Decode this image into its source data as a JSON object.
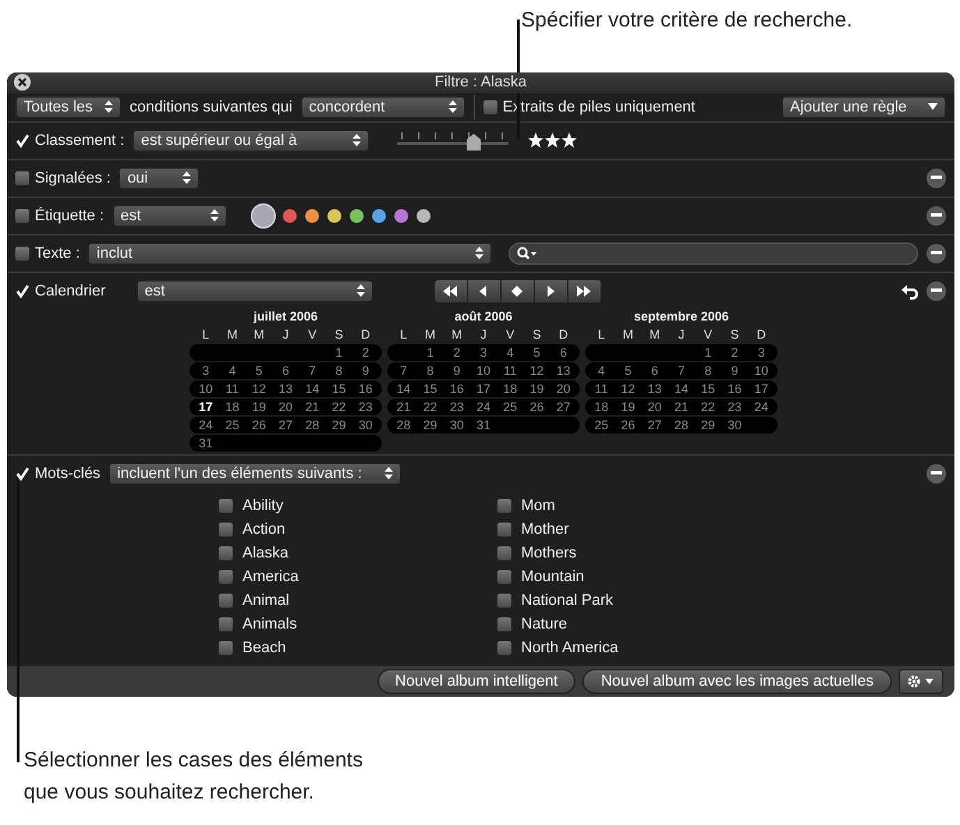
{
  "callouts": [
    {
      "text": "Spécifier votre critère de recherche."
    },
    {
      "text": "Sélectionner les cases des éléments que vous souhaitez rechercher."
    }
  ],
  "window": {
    "title": "Filtre : Alaska"
  },
  "toolbar": {
    "match_popup": "Toutes les",
    "text": "conditions suivantes qui",
    "mode_popup": "concordent",
    "stacks_checkbox": {
      "label": "Extraits de piles uniquement",
      "checked": false
    },
    "add_rule": "Ajouter une règle"
  },
  "rules": [
    {
      "kind": "rating",
      "label": "Classement :",
      "checked": true,
      "operator": "est supérieur ou égal à",
      "level": 0.68,
      "stars": 3
    },
    {
      "kind": "flag",
      "label": "Signalées :",
      "checked": false,
      "operator": "oui"
    },
    {
      "kind": "labels",
      "label": "Étiquette :",
      "checked": false,
      "operator": "est",
      "colors": [
        {
          "color": "#a8a8b4",
          "selected": true
        },
        {
          "color": "#e05858",
          "selected": false
        },
        {
          "color": "#e8924a",
          "selected": false
        },
        {
          "color": "#d8c658",
          "selected": false
        },
        {
          "color": "#78c060",
          "selected": false
        },
        {
          "color": "#58a4e4",
          "selected": false
        },
        {
          "color": "#b478d4",
          "selected": false
        },
        {
          "color": "#b8b8b8",
          "selected": false
        }
      ]
    },
    {
      "kind": "text",
      "label": "Texte :",
      "checked": false,
      "operator": "inclut"
    },
    {
      "kind": "calendar",
      "label": "Calendrier",
      "checked": true,
      "operator": "est",
      "months": [
        {
          "title": "juillet 2006",
          "weekdays": [
            "L",
            "M",
            "M",
            "J",
            "V",
            "S",
            "D"
          ],
          "weeks": [
            {
              "right_aligned": true,
              "days": [
                "1",
                "2"
              ]
            },
            {
              "days": [
                "3",
                "4",
                "5",
                "6",
                "7",
                "8",
                "9"
              ]
            },
            {
              "days": [
                "10",
                "11",
                "12",
                "13",
                "14",
                "15",
                "16"
              ]
            },
            {
              "days": [
                {
                  "day": "17",
                  "today": true
                },
                "18",
                "19",
                "20",
                "21",
                "22",
                "23"
              ]
            },
            {
              "days": [
                "24",
                "25",
                "26",
                "27",
                "28",
                "29",
                "30"
              ]
            },
            {
              "days": [
                "31"
              ]
            }
          ]
        },
        {
          "title": "août 2006",
          "weekdays": [
            "L",
            "M",
            "M",
            "J",
            "V",
            "S",
            "D"
          ],
          "weeks": [
            {
              "right_aligned": true,
              "days": [
                "1",
                "2",
                "3",
                "4",
                "5",
                "6"
              ]
            },
            {
              "days": [
                "7",
                "8",
                "9",
                "10",
                "11",
                "12",
                "13"
              ]
            },
            {
              "days": [
                "14",
                "15",
                "16",
                "17",
                "18",
                "19",
                "20"
              ]
            },
            {
              "days": [
                "21",
                "22",
                "23",
                "24",
                "25",
                "26",
                "27"
              ]
            },
            {
              "days": [
                "28",
                "29",
                "30",
                "31"
              ]
            }
          ]
        },
        {
          "title": "septembre 2006",
          "weekdays": [
            "L",
            "M",
            "M",
            "J",
            "V",
            "S",
            "D"
          ],
          "weeks": [
            {
              "right_aligned": true,
              "days": [
                "1",
                "2",
                "3"
              ]
            },
            {
              "days": [
                "4",
                "5",
                "6",
                "7",
                "8",
                "9",
                "10"
              ]
            },
            {
              "days": [
                "11",
                "12",
                "13",
                "14",
                "15",
                "16",
                "17"
              ]
            },
            {
              "days": [
                "18",
                "19",
                "20",
                "21",
                "22",
                "23",
                "24"
              ]
            },
            {
              "days": [
                "25",
                "26",
                "27",
                "28",
                "29",
                "30"
              ]
            }
          ]
        }
      ]
    },
    {
      "kind": "keywords",
      "label": "Mots-clés",
      "checked": true,
      "operator": "incluent l'un des éléments suivants :",
      "keywords": [
        {
          "label": "Ability",
          "checked": false
        },
        {
          "label": "Action",
          "checked": false
        },
        {
          "label": "Alaska",
          "checked": false
        },
        {
          "label": "America",
          "checked": false
        },
        {
          "label": "Animal",
          "checked": false
        },
        {
          "label": "Animals",
          "checked": false
        },
        {
          "label": "Beach",
          "checked": false
        },
        {
          "label": "Mom",
          "checked": false
        },
        {
          "label": "Mother",
          "checked": false
        },
        {
          "label": "Mothers",
          "checked": false
        },
        {
          "label": "Mountain",
          "checked": false
        },
        {
          "label": "National Park",
          "checked": false
        },
        {
          "label": "Nature",
          "checked": false
        },
        {
          "label": "North America",
          "checked": false
        }
      ]
    }
  ],
  "buttons": [
    "Nouvel album intelligent",
    "Nouvel album avec les images actuelles"
  ]
}
